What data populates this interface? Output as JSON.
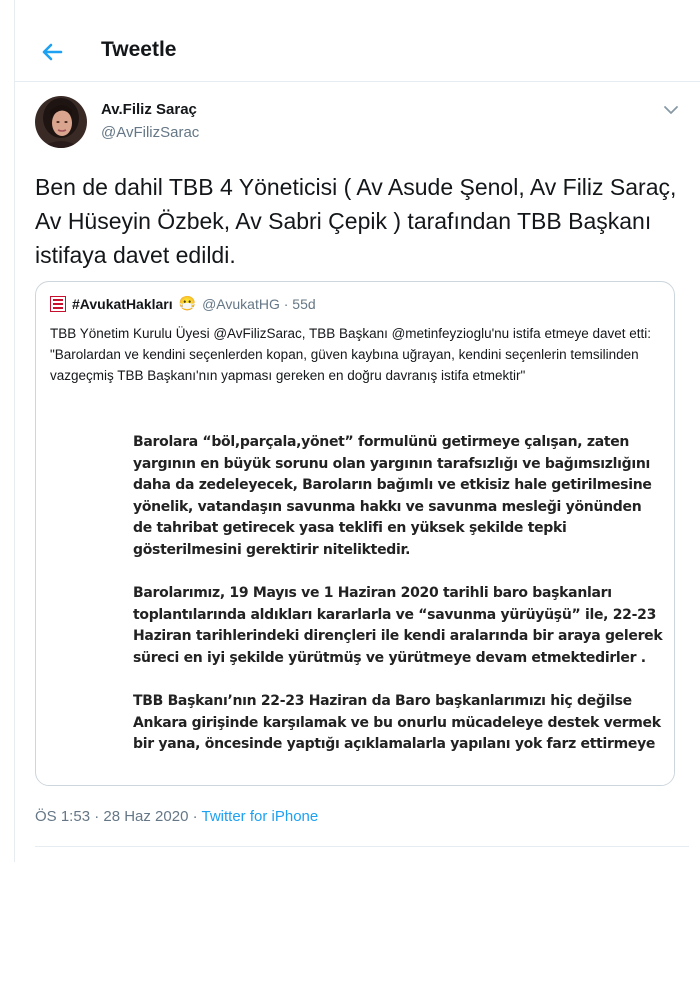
{
  "header": {
    "title": "Tweetle",
    "back_icon": "arrow-left-icon"
  },
  "colors": {
    "accent": "#1da1f2",
    "muted": "#657786",
    "border": "#ccd6dd"
  },
  "tweet": {
    "author_name": "Av.Filiz Saraç",
    "author_handle": "@AvFilizSarac",
    "text": "Ben de dahil TBB 4 Yöneticisi ( Av Asude Şenol, Av Filiz Saraç, Av Hüseyin Özbek, Av Sabri Çepik ) tarafından TBB Başkanı istifaya davet edildi.",
    "timestamp": "ÖS 1:53 · 28 Haz 2020 · ",
    "source": "Twitter for iPhone"
  },
  "quote": {
    "name": "#AvukatHakları",
    "emoji": "😷",
    "meta": "@AvukatHG · 55d",
    "text": "TBB Yönetim Kurulu Üyesi @AvFilizSarac, TBB Başkanı @metinfeyzioglu'nu istifa etmeye davet etti: \"Barolardan ve kendini seçenlerden kopan, güven kaybına uğrayan, kendini seçenlerin temsilinden vazgeçmiş TBB Başkanı'nın yapması gereken en doğru davranış istifa etmektir\"",
    "image_paragraphs": [
      "Barolara “böl,parçala,yönet” formulünü getirmeye çalışan, zaten yargının en büyük sorunu olan yargının tarafsızlığı ve bağımsızlığını daha da zedeleyecek, Baroların bağımlı ve etkisiz hale getirilmesine yönelik, vatandaşın savunma hakkı ve savunma mesleği yönünden de tahribat getirecek yasa teklifi en yüksek şekilde tepki gösterilmesini gerektirir niteliktedir.",
      "Barolarımız, 19 Mayıs ve 1 Haziran 2020 tarihli baro başkanları toplantılarında aldıkları kararlarla ve “savunma yürüyüşü” ile, 22-23 Haziran tarihlerindeki dirençleri ile kendi aralarında bir araya gelerek süreci en iyi şekilde yürütmüş ve yürütmeye devam etmektedirler .",
      "TBB Başkanı’nın 22-23 Haziran da Baro başkanlarımızı hiç değilse Ankara girişinde karşılamak ve bu onurlu mücadeleye destek vermek bir yana, öncesinde yaptığı açıklamalarla yapılanı yok farz ettirmeye"
    ]
  }
}
